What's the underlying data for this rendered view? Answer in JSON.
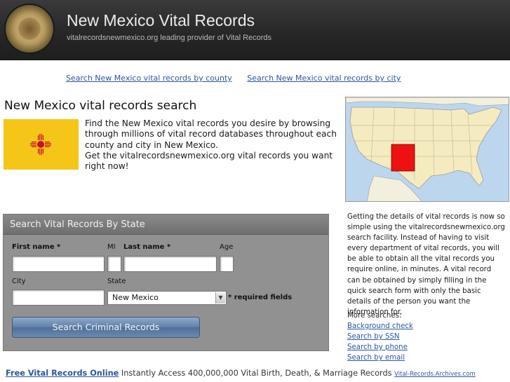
{
  "header": {
    "title": "New Mexico Vital Records",
    "tagline": "vitalrecordsnewmexico.org leading provider of Vital Records"
  },
  "top_links": [
    {
      "label": "Search New Mexico vital records by county"
    },
    {
      "label": "Search New Mexico vital records by city"
    }
  ],
  "main": {
    "title": "New Mexico vital records search",
    "intro_1": "Find the New Mexico vital records you desire by browsing through millions of vital record databases throughout each county and city in New Mexico.",
    "intro_2": "Get the vitalrecordsnewmexico.org vital records you want right now!"
  },
  "form": {
    "heading": "Search Vital Records By State",
    "first_name_label": "First name *",
    "mi_label": "MI",
    "last_name_label": "Last name *",
    "age_label": "Age",
    "city_label": "City",
    "state_label": "State",
    "state_value": "New Mexico",
    "required_note": "* required fields",
    "button_label": "Search Criminal Records"
  },
  "side": {
    "description": "Getting the details of vital records is now so simple using the vitalrecordsnewmexico.org search facility. Instead of having to visit every department of vital records, you will be able to obtain all the vital records you require online, in minutes. A vital record can be obtained by simply filling in the quick search form with only the basic details of the person you want the information for.",
    "more_label": "More searches:",
    "more_links": [
      "Background check",
      "Search by SSN",
      "Search by phone",
      "Search by email"
    ]
  },
  "footer": {
    "link": "Free Vital Records Online",
    "text": "Instantly Access 400,000,000 Vital Birth, Death, & Marriage Records",
    "source": "Vital-Records.Archives.com"
  },
  "colors": {
    "header_bg": "#262626",
    "link": "#2a56a0",
    "flag_yellow": "#f5c518",
    "flag_red": "#c8102e",
    "highlight_state": "#ee1111"
  }
}
